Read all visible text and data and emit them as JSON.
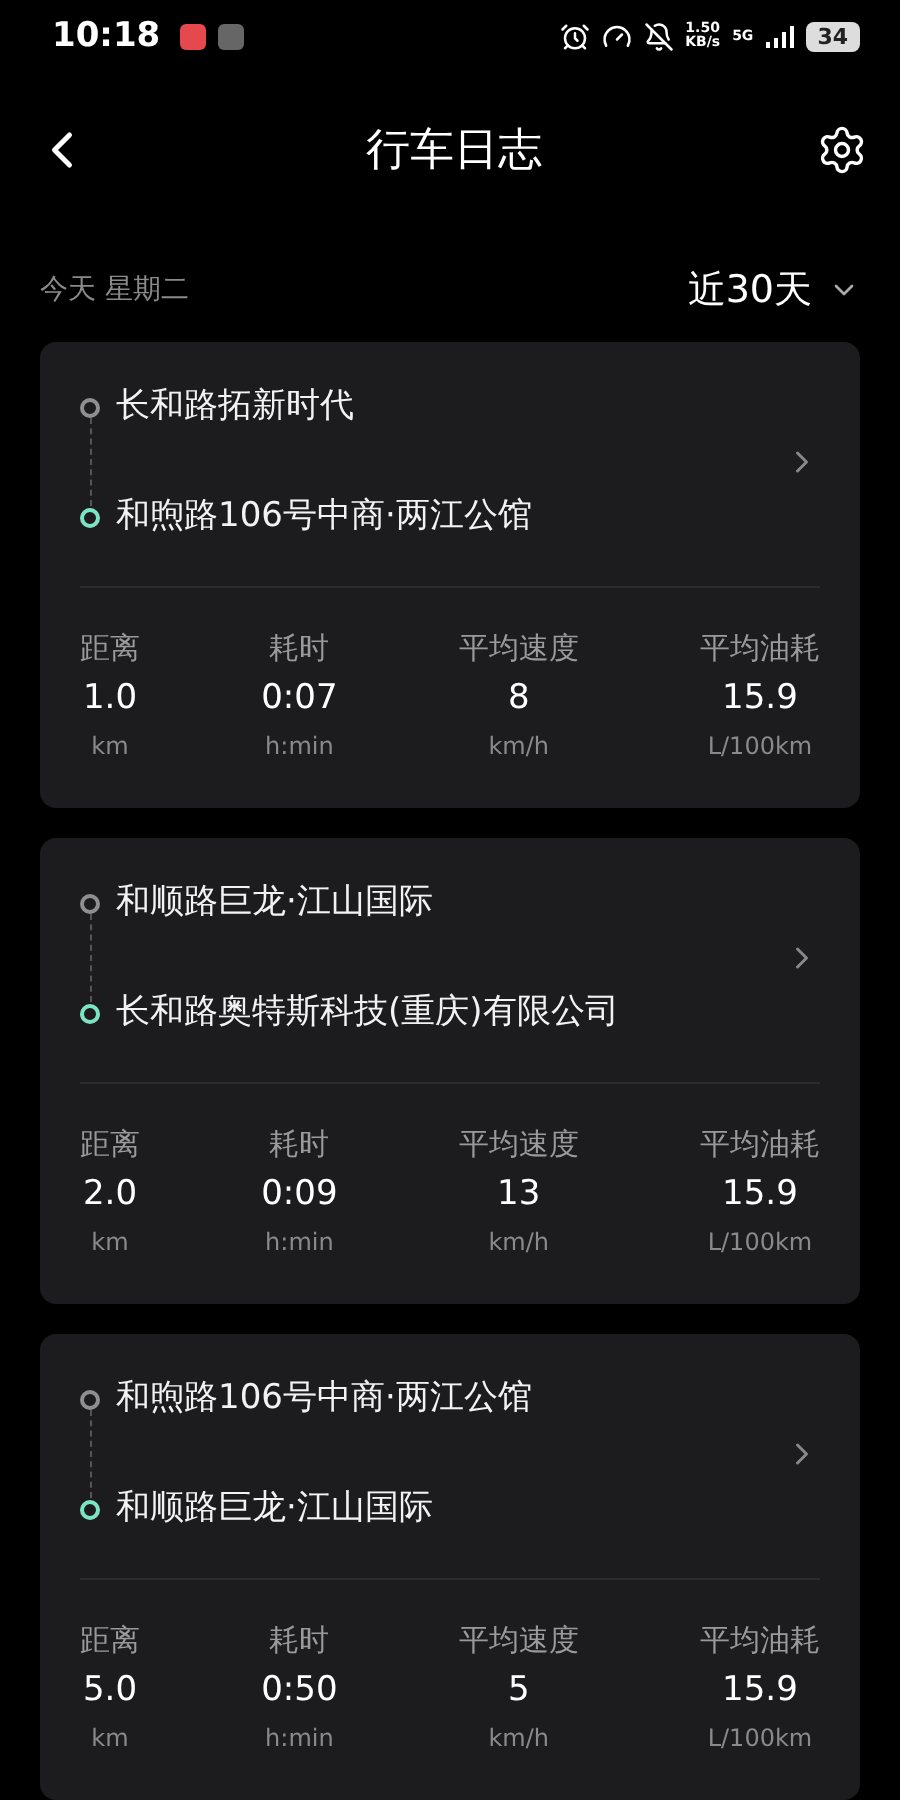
{
  "status_bar": {
    "time": "10:18",
    "speed": "1.50",
    "speed_unit": "KB/s",
    "network": "5G",
    "battery": "34"
  },
  "header": {
    "title": "行车日志"
  },
  "filter": {
    "date": "今天 星期二",
    "range": "近30天"
  },
  "trips": [
    {
      "start": "长和路拓新时代",
      "end": "和煦路106号中商·两江公馆",
      "stats": [
        {
          "label": "距离",
          "value": "1.0",
          "unit": "km"
        },
        {
          "label": "耗时",
          "value": "0:07",
          "unit": "h:min"
        },
        {
          "label": "平均速度",
          "value": "8",
          "unit": "km/h"
        },
        {
          "label": "平均油耗",
          "value": "15.9",
          "unit": "L/100km"
        }
      ]
    },
    {
      "start": "和顺路巨龙·江山国际",
      "end": "长和路奥特斯科技(重庆)有限公司",
      "stats": [
        {
          "label": "距离",
          "value": "2.0",
          "unit": "km"
        },
        {
          "label": "耗时",
          "value": "0:09",
          "unit": "h:min"
        },
        {
          "label": "平均速度",
          "value": "13",
          "unit": "km/h"
        },
        {
          "label": "平均油耗",
          "value": "15.9",
          "unit": "L/100km"
        }
      ]
    },
    {
      "start": "和煦路106号中商·两江公馆",
      "end": "和顺路巨龙·江山国际",
      "stats": [
        {
          "label": "距离",
          "value": "5.0",
          "unit": "km"
        },
        {
          "label": "耗时",
          "value": "0:50",
          "unit": "h:min"
        },
        {
          "label": "平均速度",
          "value": "5",
          "unit": "km/h"
        },
        {
          "label": "平均油耗",
          "value": "15.9",
          "unit": "L/100km"
        }
      ]
    }
  ]
}
